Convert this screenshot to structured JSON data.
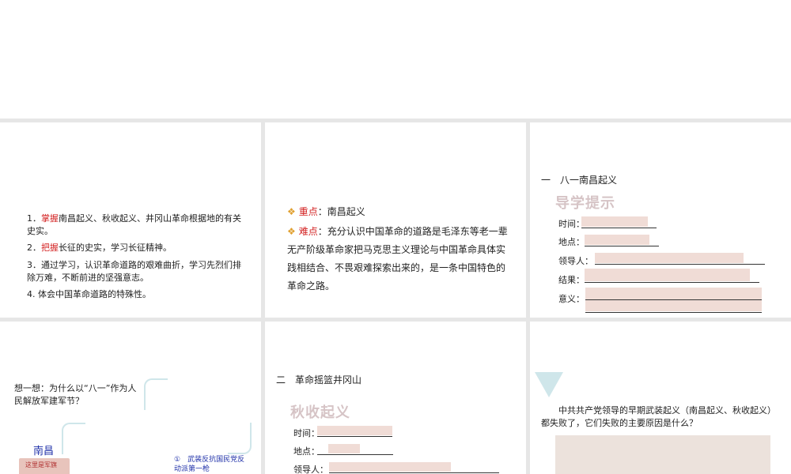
{
  "slide1": {
    "items": [
      {
        "num": "1．",
        "highlight": "掌握",
        "text": "南昌起义、秋收起义、井冈山革命根据地的有关史实。"
      },
      {
        "num": "2．",
        "highlight": "把握",
        "text": "长征的史实，学习长征精神。"
      },
      {
        "num": "3．",
        "highlight": "",
        "text": "通过学习，认识革命道路的艰难曲折，学习先烈们排除万难，不断前进的坚强意志。"
      },
      {
        "num": "4.",
        "highlight": "",
        "text": "体会中国革命道路的特殊性。"
      }
    ]
  },
  "slide2": {
    "key_label": "重点",
    "key_text": "：南昌起义",
    "diff_label": "难点",
    "diff_text": "：充分认识中国革命的道路是毛泽东等老一辈无产阶级革命家把马克思主义理论与中国革命具体实践相结合、不畏艰难探索出来的，是一条中国特色的革命之路。"
  },
  "slide3": {
    "heading": "一　八一南昌起义",
    "stamp": "导学提示",
    "fields": [
      "时间：",
      "地点：",
      "领导人：",
      "结果：",
      "意义："
    ]
  },
  "slide4": {
    "question": "想一想：为什么以“八一”作为人民解放军建军节？",
    "place": "南昌",
    "tag": "这里是军旗",
    "point": "①　武装反抗国民党反动派第一枪"
  },
  "slide5": {
    "heading": "二　革命摇篮井冈山",
    "stamp": "秋收起义",
    "fields": [
      "时间：",
      "地点：",
      "领导人："
    ]
  },
  "slide6": {
    "question": "中共共产党领导的早期武装起义（南昌起义、秋收起义）都失败了，它们失败的主要原因是什么？"
  },
  "colors": {
    "background": "#e6e6e6",
    "highlight_red": "#d32222",
    "bullet": "#e0a030",
    "answer_fill": "#f0dcd6",
    "stamp": "#d6c4c6",
    "accent_teal": "#cfe6ea",
    "place_blue": "#2233aa"
  }
}
